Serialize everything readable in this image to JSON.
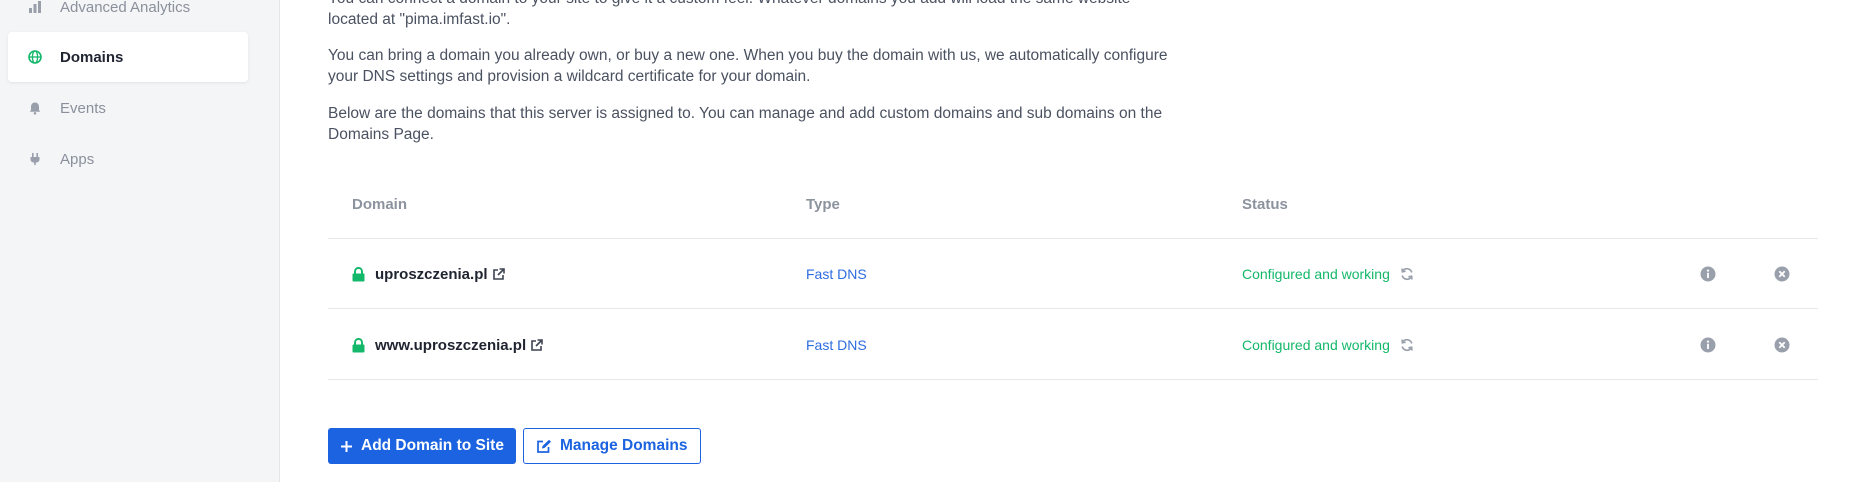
{
  "sidebar": {
    "items": [
      {
        "label": "Advanced Analytics",
        "icon": "chart-icon"
      },
      {
        "label": "Domains",
        "icon": "globe-icon",
        "active": true
      },
      {
        "label": "Events",
        "icon": "bell-icon"
      },
      {
        "label": "Apps",
        "icon": "plug-icon"
      }
    ]
  },
  "intro": {
    "p1_line1": "You can connect a domain to your site to give it a custom feel. Whatever domains you add will load the same website",
    "p1_line2": "located at \"pima.imfast.io\".",
    "p2_line1": "You can bring a domain you already own, or buy a new one. When you buy the domain with us, we automatically configure",
    "p2_line2": "your DNS settings and provision a wildcard certificate for your domain.",
    "p3_line1": "Below are the domains that this server is assigned to. You can manage and add custom domains and sub domains on the",
    "p3_line2": "Domains Page."
  },
  "table": {
    "headers": {
      "domain": "Domain",
      "type": "Type",
      "status": "Status"
    },
    "rows": [
      {
        "domain": "uproszczenia.pl",
        "type": "Fast DNS",
        "status": "Configured and working"
      },
      {
        "domain": "www.uproszczenia.pl",
        "type": "Fast DNS",
        "status": "Configured and working"
      }
    ]
  },
  "actions": {
    "add_label": "Add Domain to Site",
    "manage_label": "Manage Domains"
  },
  "colors": {
    "primary": "#1b63e0",
    "success": "#13b86a",
    "link": "#2d6cdf",
    "sidebar_bg": "#f4f5f7"
  }
}
